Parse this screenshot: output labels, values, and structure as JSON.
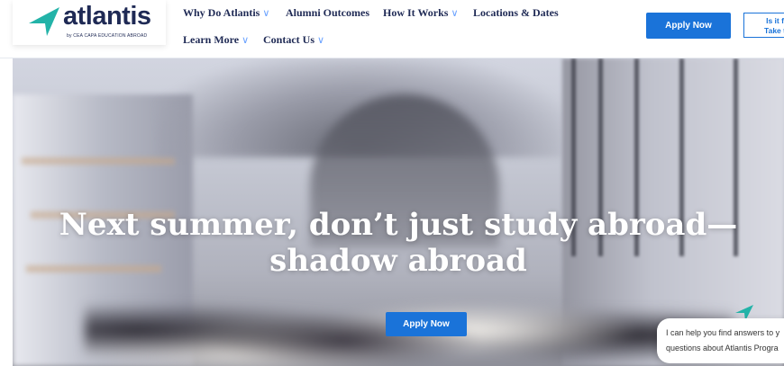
{
  "header": {
    "logo": {
      "word": "atlantis",
      "tagline": "by CEA CAPA EDUCATION ABROAD"
    },
    "nav": [
      {
        "label": "Why Do Atlantis",
        "has_dropdown": true
      },
      {
        "label": "Alumni Outcomes",
        "has_dropdown": false
      },
      {
        "label": "How It Works",
        "has_dropdown": true
      },
      {
        "label": "Locations & Dates",
        "has_dropdown": false
      },
      {
        "label": "Learn More",
        "has_dropdown": true
      },
      {
        "label": "Contact Us",
        "has_dropdown": true
      }
    ],
    "apply_label": "Apply Now",
    "fit_line1": "Is it f",
    "fit_line2": "Take t",
    "chevron": "∨"
  },
  "hero": {
    "title_line1": "Next summer, don’t just study abroad—",
    "title_line2": "shadow abroad",
    "apply_label": "Apply Now"
  },
  "chat": {
    "line1": "I can help you find answers to y",
    "line2": "questions about Atlantis Progra"
  },
  "colors": {
    "accent": "#1a73d9",
    "brand_navy": "#1f2a55",
    "brand_teal": "#23b3a8"
  }
}
